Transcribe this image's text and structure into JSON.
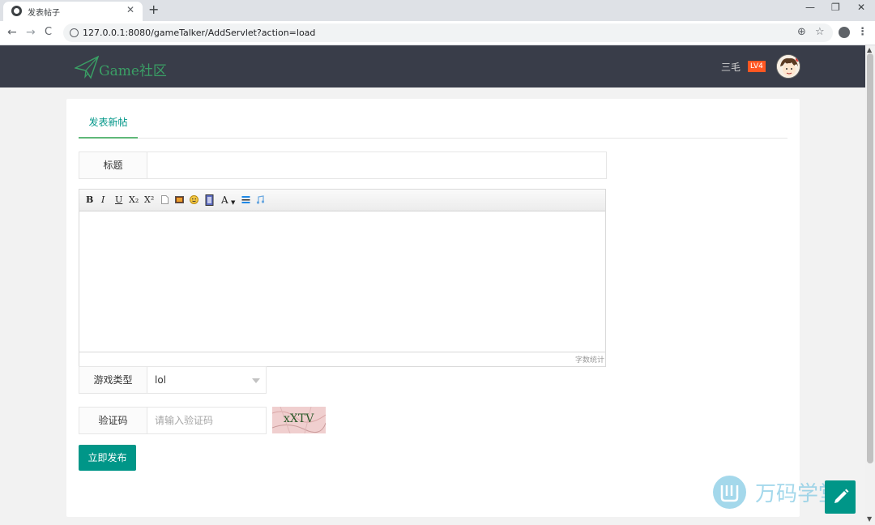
{
  "browser": {
    "tab_title": "发表帖子",
    "tab_close": "✕",
    "new_tab": "+",
    "url": "127.0.0.1:8080/gameTalker/AddServlet?action=load",
    "back": "←",
    "forward": "→",
    "reload": "C",
    "zoom": "⊕",
    "bookmark": "☆",
    "menu": "⋮",
    "minimize": "—",
    "restore": "❐",
    "close": "✕"
  },
  "header": {
    "logo_text": "Game社区",
    "username": "三毛",
    "level": "LV4"
  },
  "tabs": [
    {
      "label": "发表新帖",
      "active": true
    }
  ],
  "form": {
    "title_label": "标题",
    "title_value": "",
    "editor_toolbar": [
      "B",
      "I",
      "U",
      "X₂",
      "X²",
      "A"
    ],
    "word_count_label": "字数统计",
    "game_type_label": "游戏类型",
    "game_type_value": "lol",
    "captcha_label": "验证码",
    "captcha_placeholder": "请输入验证码",
    "captcha_text": "xXTV",
    "submit_label": "立即发布"
  },
  "watermark": {
    "text": "万码学堂"
  },
  "colors": {
    "header_bg": "#393d49",
    "accent": "#009688",
    "tab_underline": "#5fb878",
    "badge": "#ff5722"
  }
}
